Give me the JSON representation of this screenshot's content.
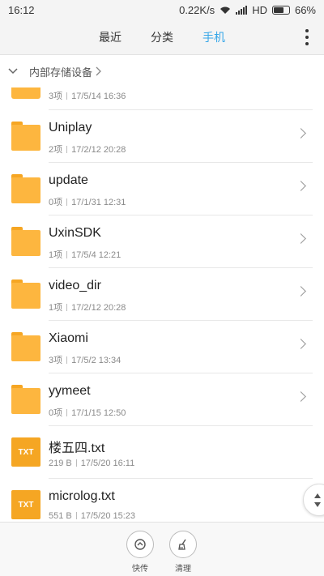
{
  "status": {
    "time": "16:12",
    "speed": "0.22K/s",
    "network": "HD",
    "battery": "66%",
    "battery_level": 0.66
  },
  "tabs": [
    {
      "label": "最近",
      "active": false
    },
    {
      "label": "分类",
      "active": false
    },
    {
      "label": "手机",
      "active": true
    }
  ],
  "breadcrumb": {
    "label": "内部存储设备"
  },
  "partial_item": {
    "count": "3项",
    "date": "17/5/14 16:36"
  },
  "items": [
    {
      "name": "Uniplay",
      "count": "2项",
      "date": "17/2/12 20:28",
      "type": "folder"
    },
    {
      "name": "update",
      "count": "0项",
      "date": "17/1/31 12:31",
      "type": "folder"
    },
    {
      "name": "UxinSDK",
      "count": "1项",
      "date": "17/5/4 12:21",
      "type": "folder"
    },
    {
      "name": "video_dir",
      "count": "1项",
      "date": "17/2/12 20:28",
      "type": "folder"
    },
    {
      "name": "Xiaomi",
      "count": "3项",
      "date": "17/5/2 13:34",
      "type": "folder"
    },
    {
      "name": "yymeet",
      "count": "0项",
      "date": "17/1/15 12:50",
      "type": "folder"
    },
    {
      "name": "楼五四.txt",
      "count": "219 B",
      "date": "17/5/20 16:11",
      "type": "txt"
    },
    {
      "name": "microlog.txt",
      "count": "551 B",
      "date": "17/5/20 15:23",
      "type": "txt"
    }
  ],
  "file_badge": "TXT",
  "bottom_actions": [
    {
      "label": "快传",
      "icon": "share-icon"
    },
    {
      "label": "清理",
      "icon": "broom-icon"
    }
  ],
  "colors": {
    "accent": "#35a6e8",
    "folder": "#fdb63f",
    "txt": "#f5a623"
  }
}
